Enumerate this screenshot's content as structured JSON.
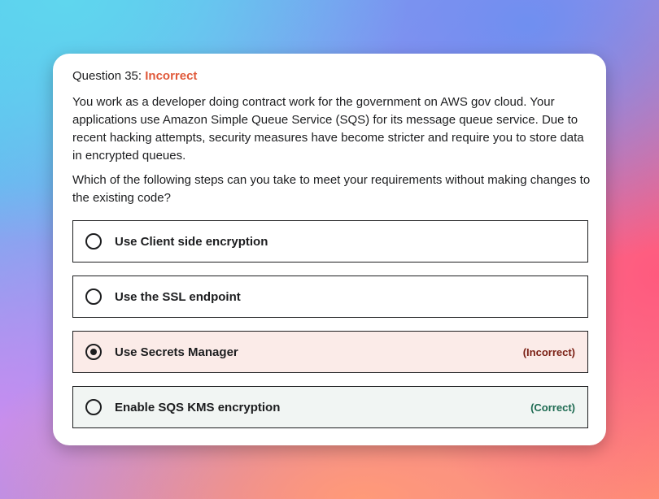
{
  "question": {
    "prefix": "Question 35:",
    "status": "Incorrect",
    "text": "You work as a developer doing contract work for the government on AWS gov cloud. Your applications use Amazon Simple Queue Service (SQS) for its message queue service. Due to recent hacking attempts, security measures have become stricter and require you to store data in encrypted queues.",
    "prompt": "Which of the following steps can you take to meet your requirements without making changes to the existing code?"
  },
  "options": [
    {
      "label": "Use Client side encryption",
      "tag": ""
    },
    {
      "label": "Use the SSL endpoint",
      "tag": ""
    },
    {
      "label": "Use Secrets Manager",
      "tag": "(Incorrect)",
      "selected": true
    },
    {
      "label": "Enable SQS KMS encryption",
      "tag": "(Correct)"
    }
  ],
  "colors": {
    "incorrect": "#e0593a",
    "incorrect_bg": "#fbebe8",
    "correct": "#1e6b52",
    "correct_bg": "#f1f5f3"
  }
}
